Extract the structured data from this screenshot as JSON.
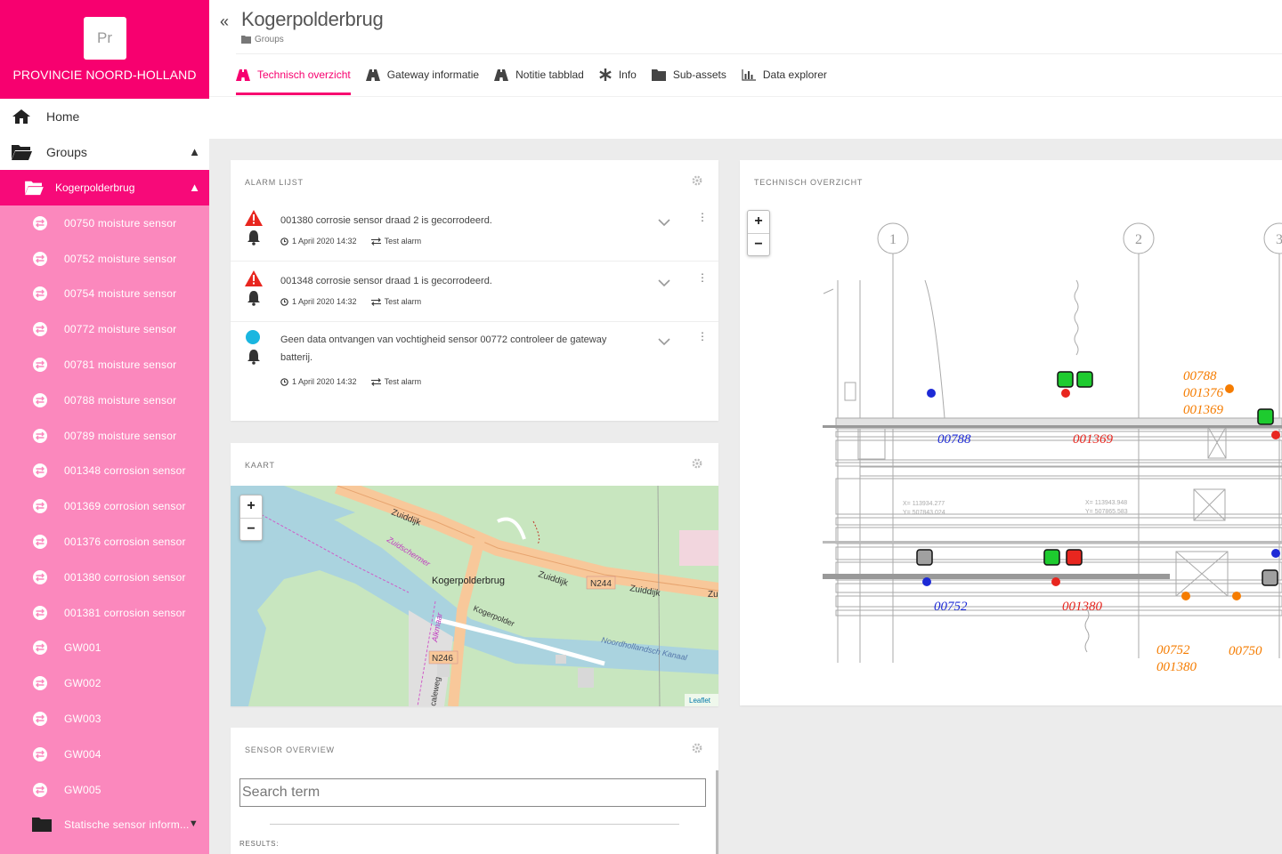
{
  "brand": {
    "logo_text": "Pr",
    "name": "PROVINCIE NOORD-HOLLAND",
    "color": "#f7006f"
  },
  "nav": {
    "home": "Home",
    "groups": "Groups",
    "active": "Kogerpolderbrug",
    "items": [
      "00750 moisture sensor",
      "00752 moisture sensor",
      "00754 moisture sensor",
      "00772 moisture sensor",
      "00781 moisture sensor",
      "00788 moisture sensor",
      "00789 moisture sensor",
      "001348 corrosion sensor",
      "001369 corrosion sensor",
      "001376 corrosion sensor",
      "001380 corrosion sensor",
      "001381 corrosion sensor",
      "GW001",
      "GW002",
      "GW003",
      "GW004",
      "GW005"
    ],
    "last_item": "Statische sensor inform..."
  },
  "header": {
    "collapse": "«",
    "title": "Kogerpolderbrug",
    "breadcrumb": "Groups",
    "tabs": [
      {
        "label": "Technisch overzicht",
        "icon": "road-icon",
        "active": true
      },
      {
        "label": "Gateway informatie",
        "icon": "road-icon"
      },
      {
        "label": "Notitie tabblad",
        "icon": "road-icon"
      },
      {
        "label": "Info",
        "icon": "asterisk-icon"
      },
      {
        "label": "Sub-assets",
        "icon": "folder-icon"
      },
      {
        "label": "Data explorer",
        "icon": "bar-chart-icon"
      }
    ]
  },
  "alarms": {
    "title": "ALARM LIJST",
    "items": [
      {
        "message": "001380 corrosie sensor draad 2 is gecorrodeerd.",
        "date": "1 April 2020 14:32",
        "type": "Test alarm",
        "severity": "warning"
      },
      {
        "message": "001348 corrosie sensor draad 1 is gecorrodeerd.",
        "date": "1 April 2020 14:32",
        "type": "Test alarm",
        "severity": "warning"
      },
      {
        "message": "Geen data ontvangen van vochtigheid sensor 00772 controleer de gateway batterij.",
        "date": "1 April 2020 14:32",
        "type": "Test alarm",
        "severity": "info"
      }
    ]
  },
  "map": {
    "title": "KAART",
    "zoom_in": "+",
    "zoom_out": "−",
    "labels": {
      "road1": "Zuiddijk",
      "canal": "Zuidschermer",
      "bridge": "Kogerpolderbrug",
      "n244": "N244",
      "road2": "Zuiddijk",
      "road3": "Zu",
      "alkmaar": "Alkmaar",
      "kogerpolder": "Kogerpolder",
      "n246": "N246",
      "canal2": "Noordhollandsch Kanaal",
      "weg": "caleweg",
      "attribution": "Leaflet"
    }
  },
  "sensors": {
    "title": "SENSOR OVERVIEW",
    "search_placeholder": "Search term",
    "results": "RESULTS:"
  },
  "tech": {
    "title": "TECHNISCH OVERZICHT",
    "zoom_in": "+",
    "zoom_out": "−",
    "grid_labels": [
      "1",
      "2",
      "3"
    ],
    "labels": {
      "top_right_1": "00788",
      "top_right_2": "001376",
      "top_right_3": "001369",
      "blue_top": "00788",
      "red_top": "001369",
      "gray_bottom": "00752",
      "red_bottom": "001380",
      "orange_bl_1": "00752",
      "orange_bl_2": "001380",
      "orange_br": "00750",
      "coord1a": "X= 113934.277",
      "coord1b": "Y= 507843.024",
      "coord2a": "X= 113943.948",
      "coord2b": "Y= 507865.583"
    },
    "colors": {
      "green": "#1ecb2f",
      "red": "#e8261f",
      "gray": "#a0a0a0",
      "blue": "#1d2ad6",
      "orange": "#f57c00"
    }
  }
}
